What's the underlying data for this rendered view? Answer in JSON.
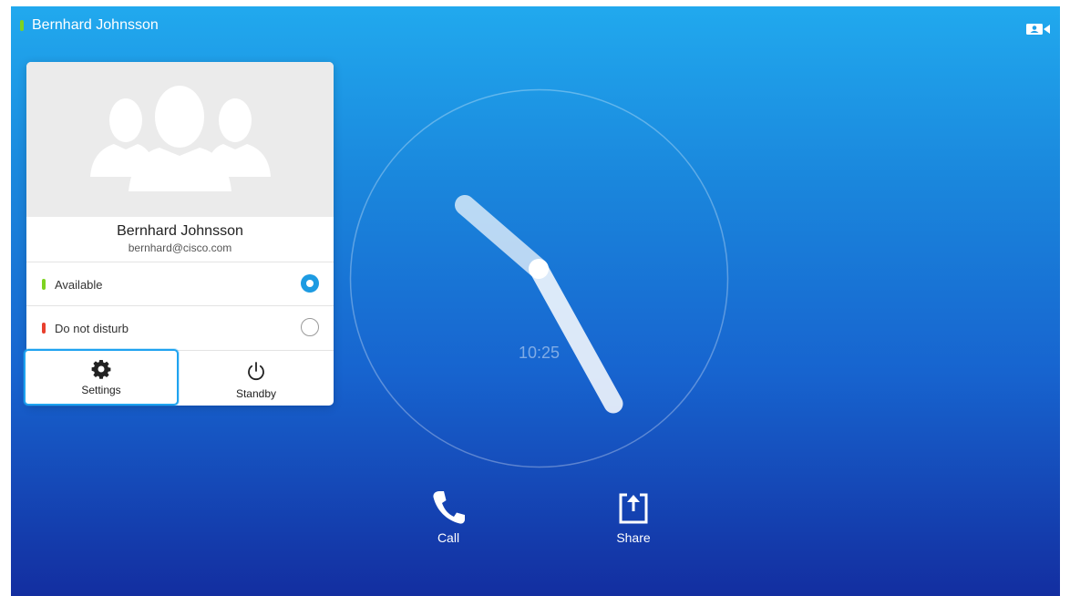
{
  "header": {
    "user_name": "Bernhard Johnsson",
    "status_color": "#7ed321",
    "camera_icon": "camera-icon"
  },
  "profile_card": {
    "name": "Bernhard Johnsson",
    "email": "bernhard@cisco.com",
    "avatar_icon": "people-placeholder-icon",
    "statuses": [
      {
        "label": "Available",
        "color": "#7ed321",
        "selected": true
      },
      {
        "label": "Do not disturb",
        "color": "#e8402e",
        "selected": false
      }
    ],
    "actions": {
      "settings_label": "Settings",
      "settings_icon": "gear-icon",
      "standby_label": "Standby",
      "standby_icon": "power-icon"
    },
    "accent_color": "#1d9be2"
  },
  "clock": {
    "time": "10:25"
  },
  "bottom_bar": {
    "call_label": "Call",
    "call_icon": "phone-icon",
    "share_label": "Share",
    "share_icon": "share-icon"
  }
}
